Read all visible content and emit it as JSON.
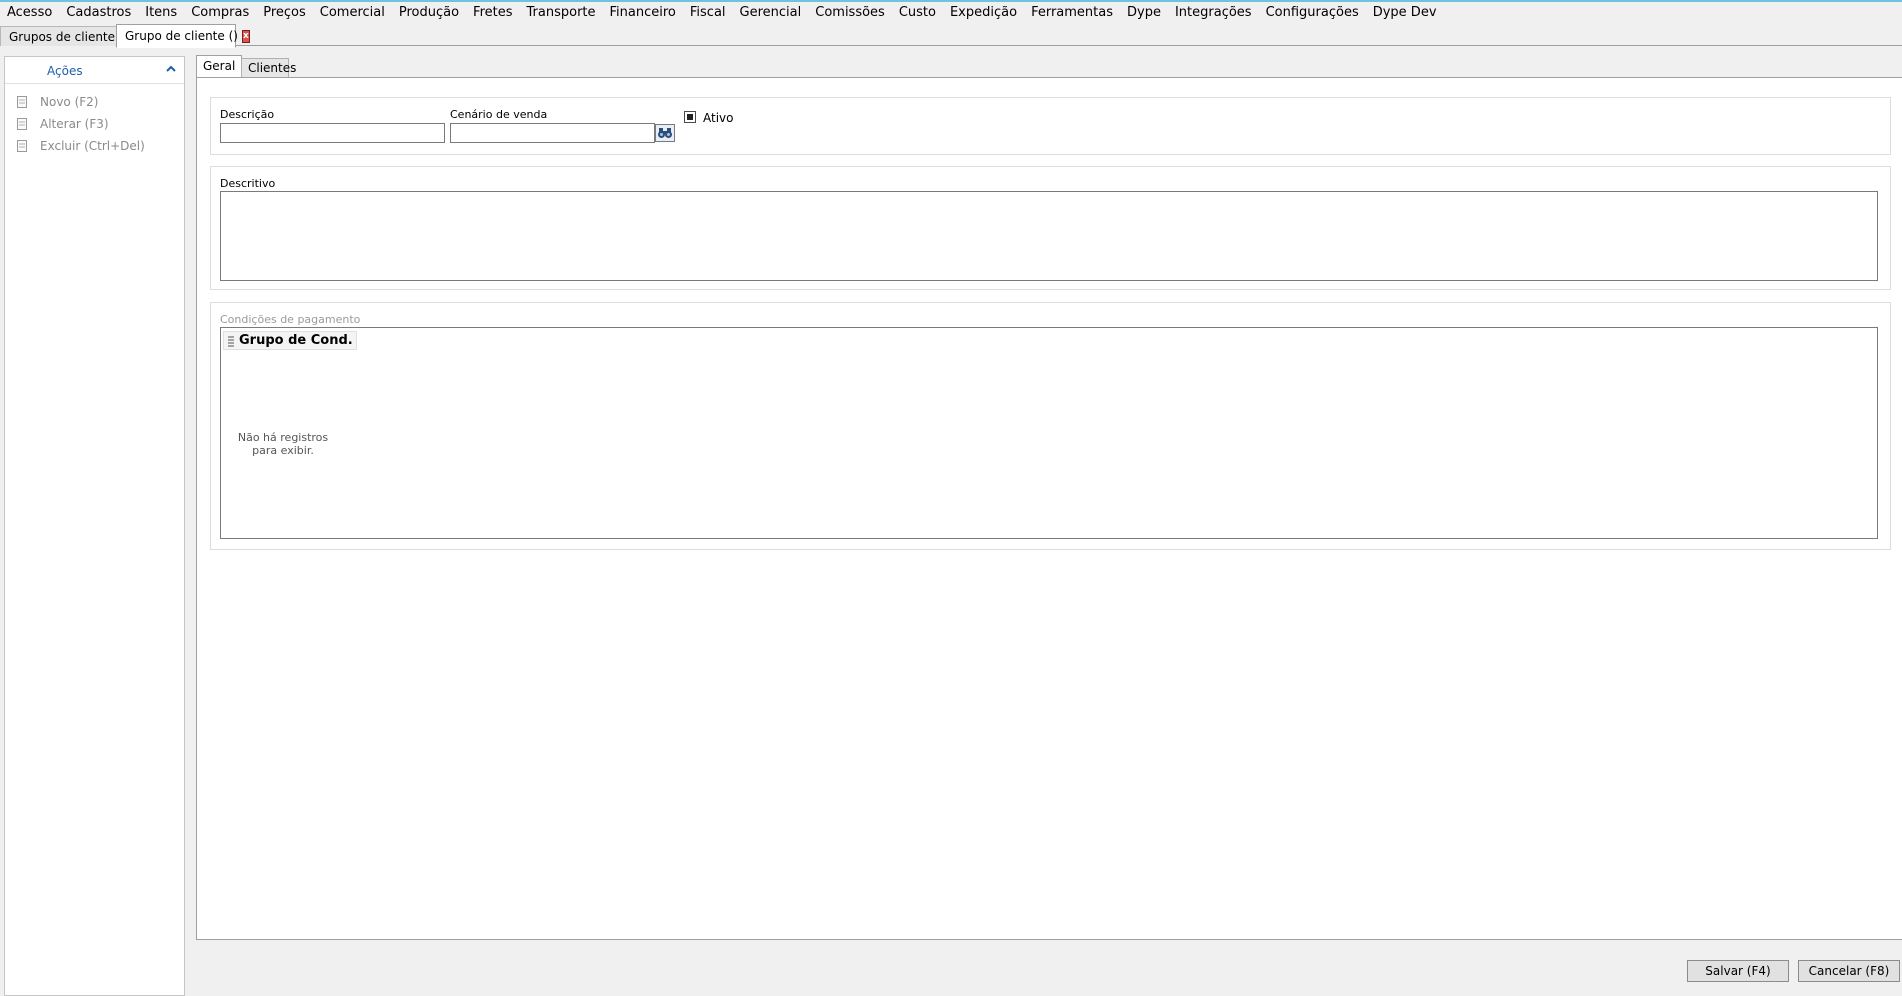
{
  "menu": [
    "Acesso",
    "Cadastros",
    "Itens",
    "Compras",
    "Preços",
    "Comercial",
    "Produção",
    "Fretes",
    "Transporte",
    "Financeiro",
    "Fiscal",
    "Gerencial",
    "Comissões",
    "Custo",
    "Expedição",
    "Ferramentas",
    "Dype",
    "Integrações",
    "Configurações",
    "Dype Dev"
  ],
  "doc_tabs": {
    "tab1": "Grupos de cliente",
    "tab2": "Grupo de cliente ()",
    "close": "x"
  },
  "actions": {
    "title": "Ações",
    "items": [
      "Novo (F2)",
      "Alterar (F3)",
      "Excluir (Ctrl+Del)"
    ]
  },
  "tabs": {
    "geral": "Geral",
    "clientes": "Clientes"
  },
  "form": {
    "descricao_label": "Descrição",
    "descricao_value": "",
    "cenario_label": "Cenário de venda",
    "cenario_value": "",
    "ativo_label": "Ativo",
    "ativo_checked": true,
    "descritivo_label": "Descritivo",
    "descritivo_value": "",
    "condicoes_label": "Condições de pagamento",
    "grid_header": "Grupo de Cond.",
    "empty_line1": "Não há registros",
    "empty_line2": "para exibir."
  },
  "buttons": {
    "save": "Salvar (F4)",
    "cancel": "Cancelar (F8)"
  },
  "colors": {
    "accent_line": "#6fc3df",
    "actions_title": "#1f5fa8",
    "close_red": "#d9534f"
  }
}
